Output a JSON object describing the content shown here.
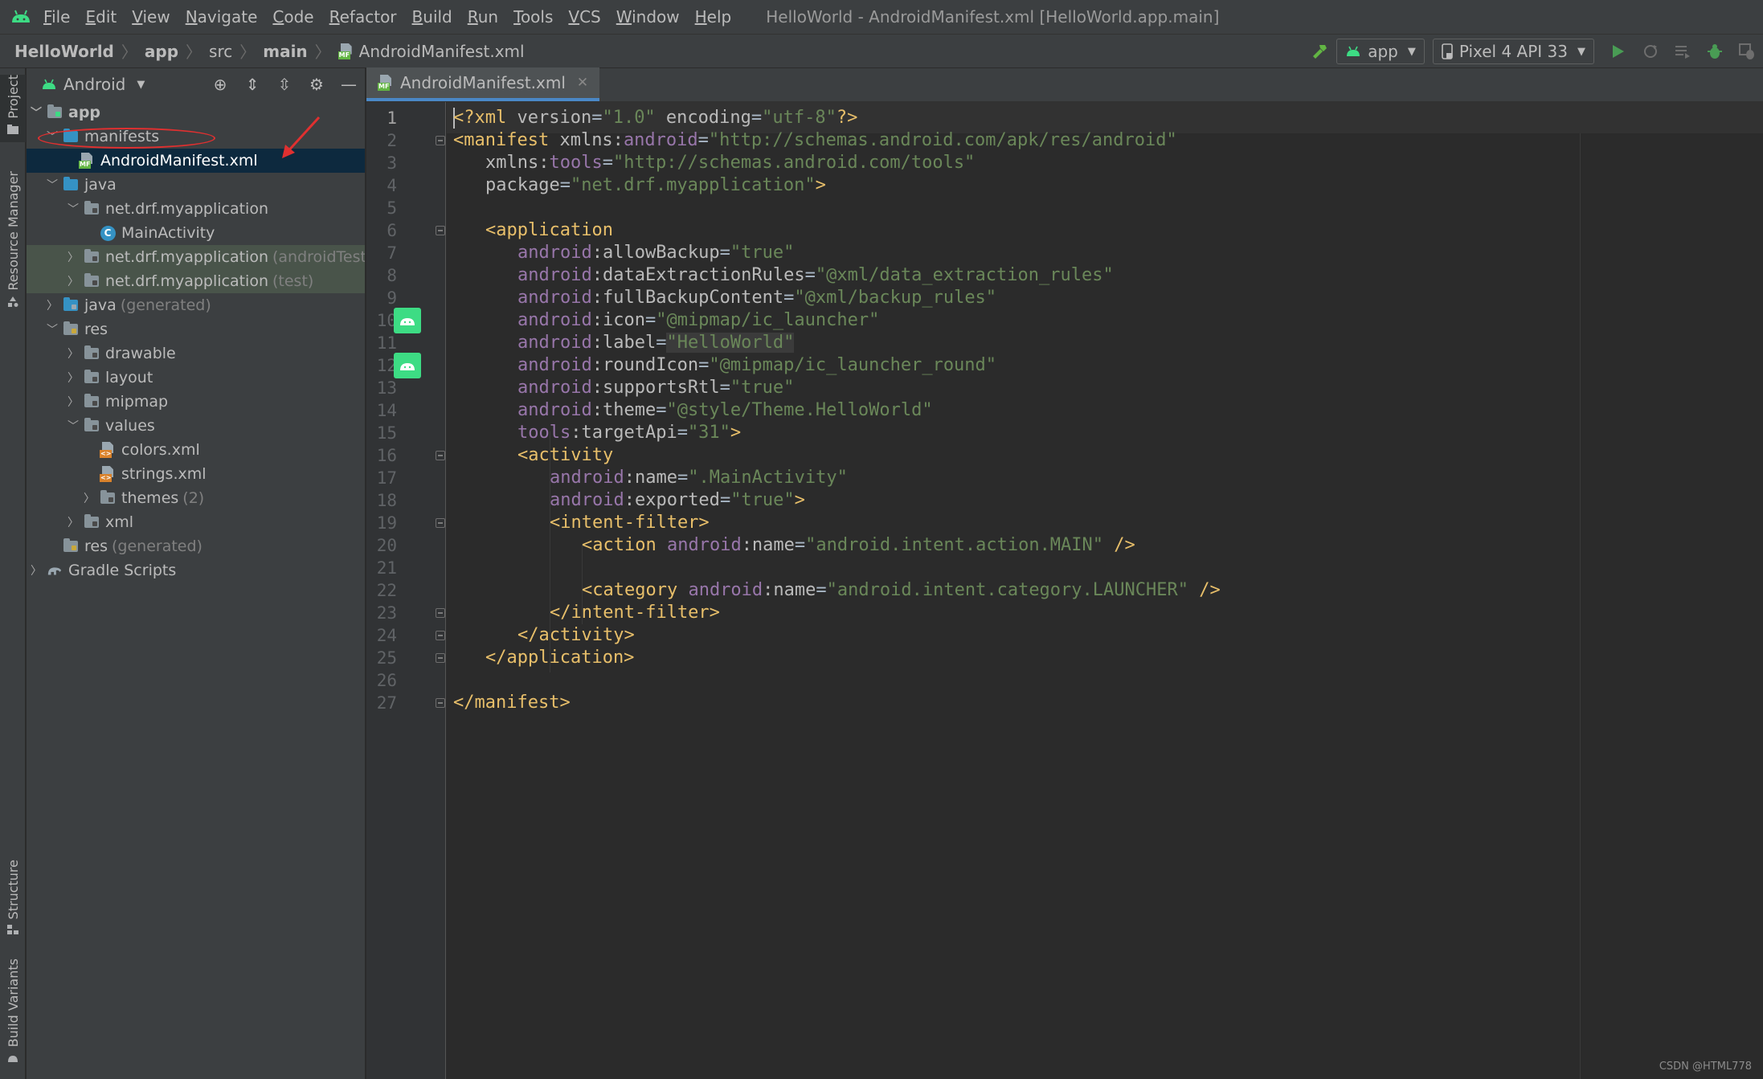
{
  "menubar": {
    "items": [
      "File",
      "Edit",
      "View",
      "Navigate",
      "Code",
      "Refactor",
      "Build",
      "Run",
      "Tools",
      "VCS",
      "Window",
      "Help"
    ],
    "window_title": "HelloWorld - AndroidManifest.xml [HelloWorld.app.main]"
  },
  "breadcrumb": {
    "items": [
      "HelloWorld",
      "app",
      "src",
      "main"
    ],
    "file": "AndroidManifest.xml"
  },
  "toolbar": {
    "run_config": "app",
    "device": "Pixel 4 API 33"
  },
  "left_strip": {
    "project": "Project",
    "resource_manager": "Resource Manager",
    "structure": "Structure",
    "build_variants": "Build Variants"
  },
  "project_panel": {
    "view_mode": "Android",
    "tree": [
      {
        "label": "app",
        "suffix": ""
      },
      {
        "label": "manifests",
        "suffix": ""
      },
      {
        "label": "AndroidManifest.xml",
        "suffix": ""
      },
      {
        "label": "java",
        "suffix": ""
      },
      {
        "label": "net.drf.myapplication",
        "suffix": ""
      },
      {
        "label": "MainActivity",
        "suffix": ""
      },
      {
        "label": "net.drf.myapplication",
        "suffix": "(androidTest)"
      },
      {
        "label": "net.drf.myapplication",
        "suffix": "(test)"
      },
      {
        "label": "java",
        "suffix": "(generated)"
      },
      {
        "label": "res",
        "suffix": ""
      },
      {
        "label": "drawable",
        "suffix": ""
      },
      {
        "label": "layout",
        "suffix": ""
      },
      {
        "label": "mipmap",
        "suffix": ""
      },
      {
        "label": "values",
        "suffix": ""
      },
      {
        "label": "colors.xml",
        "suffix": ""
      },
      {
        "label": "strings.xml",
        "suffix": ""
      },
      {
        "label": "themes",
        "suffix": "(2)"
      },
      {
        "label": "xml",
        "suffix": ""
      },
      {
        "label": "res",
        "suffix": "(generated)"
      },
      {
        "label": "Gradle Scripts",
        "suffix": ""
      }
    ]
  },
  "editor": {
    "tab": "AndroidManifest.xml",
    "lines": [
      "1",
      "2",
      "3",
      "4",
      "5",
      "6",
      "7",
      "8",
      "9",
      "10",
      "11",
      "12",
      "13",
      "14",
      "15",
      "16",
      "17",
      "18",
      "19",
      "20",
      "21",
      "22",
      "23",
      "24",
      "25",
      "26",
      "27"
    ],
    "code": {
      "l1": {
        "a": "<?xml ",
        "b": "version",
        "c": "=",
        "d": "\"1.0\"",
        "e": " encoding",
        "f": "=",
        "g": "\"utf-8\"",
        "h": "?>"
      },
      "l2": {
        "a": "<manifest ",
        "b": "xmlns:",
        "c": "android",
        "d": "=",
        "e": "\"http://schemas.android.com/apk/res/android\""
      },
      "l3": {
        "a": "xmlns:",
        "b": "tools",
        "c": "=",
        "d": "\"http://schemas.android.com/tools\""
      },
      "l4": {
        "a": "package",
        "b": "=",
        "c": "\"net.drf.myapplication\"",
        "d": ">"
      },
      "l6": {
        "a": "<application"
      },
      "l7": {
        "ns": "android",
        "at": ":allowBackup",
        "eq": "=",
        "v": "\"true\""
      },
      "l8": {
        "ns": "android",
        "at": ":dataExtractionRules",
        "eq": "=",
        "v": "\"@xml/data_extraction_rules\""
      },
      "l9": {
        "ns": "android",
        "at": ":fullBackupContent",
        "eq": "=",
        "v": "\"@xml/backup_rules\""
      },
      "l10": {
        "ns": "android",
        "at": ":icon",
        "eq": "=",
        "v": "\"@mipmap/ic_launcher\""
      },
      "l11": {
        "ns": "android",
        "at": ":label",
        "eq": "=",
        "v": "\"HelloWorld\""
      },
      "l12": {
        "ns": "android",
        "at": ":roundIcon",
        "eq": "=",
        "v": "\"@mipmap/ic_launcher_round\""
      },
      "l13": {
        "ns": "android",
        "at": ":supportsRtl",
        "eq": "=",
        "v": "\"true\""
      },
      "l14": {
        "ns": "android",
        "at": ":theme",
        "eq": "=",
        "v": "\"@style/Theme.HelloWorld\""
      },
      "l15": {
        "ns": "tools",
        "at": ":targetApi",
        "eq": "=",
        "v": "\"31\"",
        "end": ">"
      },
      "l16": {
        "a": "<activity"
      },
      "l17": {
        "ns": "android",
        "at": ":name",
        "eq": "=",
        "v": "\".MainActivity\""
      },
      "l18": {
        "ns": "android",
        "at": ":exported",
        "eq": "=",
        "v": "\"true\"",
        "end": ">"
      },
      "l19": {
        "a": "<intent-filter>"
      },
      "l20": {
        "a": "<action ",
        "ns": "android",
        "at": ":name",
        "eq": "=",
        "v": "\"android.intent.action.MAIN\"",
        "end": " />"
      },
      "l22": {
        "a": "<category ",
        "ns": "android",
        "at": ":name",
        "eq": "=",
        "v": "\"android.intent.category.LAUNCHER\"",
        "end": " />"
      },
      "l23": {
        "a": "</intent-filter>"
      },
      "l24": {
        "a": "</activity>"
      },
      "l25": {
        "a": "</application>"
      },
      "l27": {
        "a": "</manifest>"
      }
    }
  },
  "watermark": "CSDN @HTML778",
  "colors": {
    "tag": "#e8bf6a",
    "namespace": "#9876aa",
    "string": "#6a8759",
    "selection": "#0d293e",
    "android_green": "#3ddc84"
  }
}
